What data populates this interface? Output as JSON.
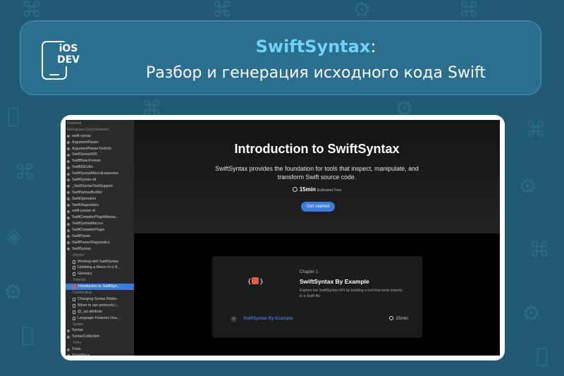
{
  "banner": {
    "logo_text_line1": "iOS",
    "logo_text_line2": "DEV",
    "title_accent": "SwiftSyntax",
    "title_rest": ":",
    "subtitle": "Разбор и генерация исходного кода Swift"
  },
  "sidebar": {
    "items": [
      {
        "label": "Featured",
        "kind": "head"
      },
      {
        "label": "Workspace Documentation",
        "kind": "head"
      },
      {
        "label": "swift-syntax",
        "kind": "dot"
      },
      {
        "label": "ArgumentParser",
        "kind": "dot"
      },
      {
        "label": "ArgumentParserToolInfo",
        "kind": "dot"
      },
      {
        "label": "SwiftSyntax509",
        "kind": "dot"
      },
      {
        "label": "SwiftBasicFormat",
        "kind": "dot"
      },
      {
        "label": "SwiftIDEUtils",
        "kind": "dot"
      },
      {
        "label": "SwiftSyntaxMacroExpansion",
        "kind": "dot"
      },
      {
        "label": "SwiftSyntax-all",
        "kind": "dot"
      },
      {
        "label": "_SwiftSyntaxTestSupport",
        "kind": "dot"
      },
      {
        "label": "SwiftSyntaxBuilder",
        "kind": "dot"
      },
      {
        "label": "SwiftOperators",
        "kind": "dot"
      },
      {
        "label": "SwiftDiagnostics",
        "kind": "dot"
      },
      {
        "label": "swift-parser-cli",
        "kind": "dot"
      },
      {
        "label": "SwiftCompilerPluginMessa...",
        "kind": "dot"
      },
      {
        "label": "SwiftSyntaxMacros",
        "kind": "dot"
      },
      {
        "label": "SwiftCompilerPlugin",
        "kind": "dot"
      },
      {
        "label": "SwiftParser",
        "kind": "dot"
      },
      {
        "label": "SwiftParserDiagnostics",
        "kind": "dot"
      },
      {
        "label": "SwiftSyntax",
        "kind": "dot"
      },
      {
        "label": "Articles",
        "kind": "head"
      },
      {
        "label": "Working with SwiftSyntax",
        "kind": "doc"
      },
      {
        "label": "Updating a Macro to a N...",
        "kind": "doc"
      },
      {
        "label": "Glossary",
        "kind": "doc"
      },
      {
        "label": "Tutorials",
        "kind": "head"
      },
      {
        "label": "Introduction to SwiftSyn...",
        "kind": "selected"
      },
      {
        "label": "Contributing",
        "kind": "head"
      },
      {
        "label": "Changing Syntax Nodes",
        "kind": "doc"
      },
      {
        "label": "When to use protocols i...",
        "kind": "doc"
      },
      {
        "label": "@_spi attribute",
        "kind": "doc"
      },
      {
        "label": "Language Features Usa...",
        "kind": "doc"
      },
      {
        "label": "Syntax",
        "kind": "head"
      },
      {
        "label": "Syntax",
        "kind": "dot"
      },
      {
        "label": "SyntaxCollection",
        "kind": "dot"
      },
      {
        "label": "Trivia",
        "kind": "head"
      },
      {
        "label": "Trivia",
        "kind": "dot"
      },
      {
        "label": "TriviaPiece",
        "kind": "dot"
      }
    ]
  },
  "hero": {
    "title": "Introduction to SwiftSyntax",
    "description": "SwiftSyntax provides the foundation for tools that inspect, manipulate, and transform Swift source code.",
    "time": "15min",
    "time_caption": "Estimated Time",
    "button": "Get started"
  },
  "card": {
    "logo_left": "{",
    "logo_right": "}",
    "chapter": "Chapter 1",
    "title": "SwiftSyntax By Example",
    "description": "Explore the SwiftSyntax API by building a tool that sorts imports in a Swift file.",
    "link": "SwiftSyntax By Example",
    "time": "15min"
  },
  "colors": {
    "background": "#1f5a72",
    "banner": "#2a6f8e",
    "accent": "#72d3f8",
    "button": "#3b7ddd"
  }
}
